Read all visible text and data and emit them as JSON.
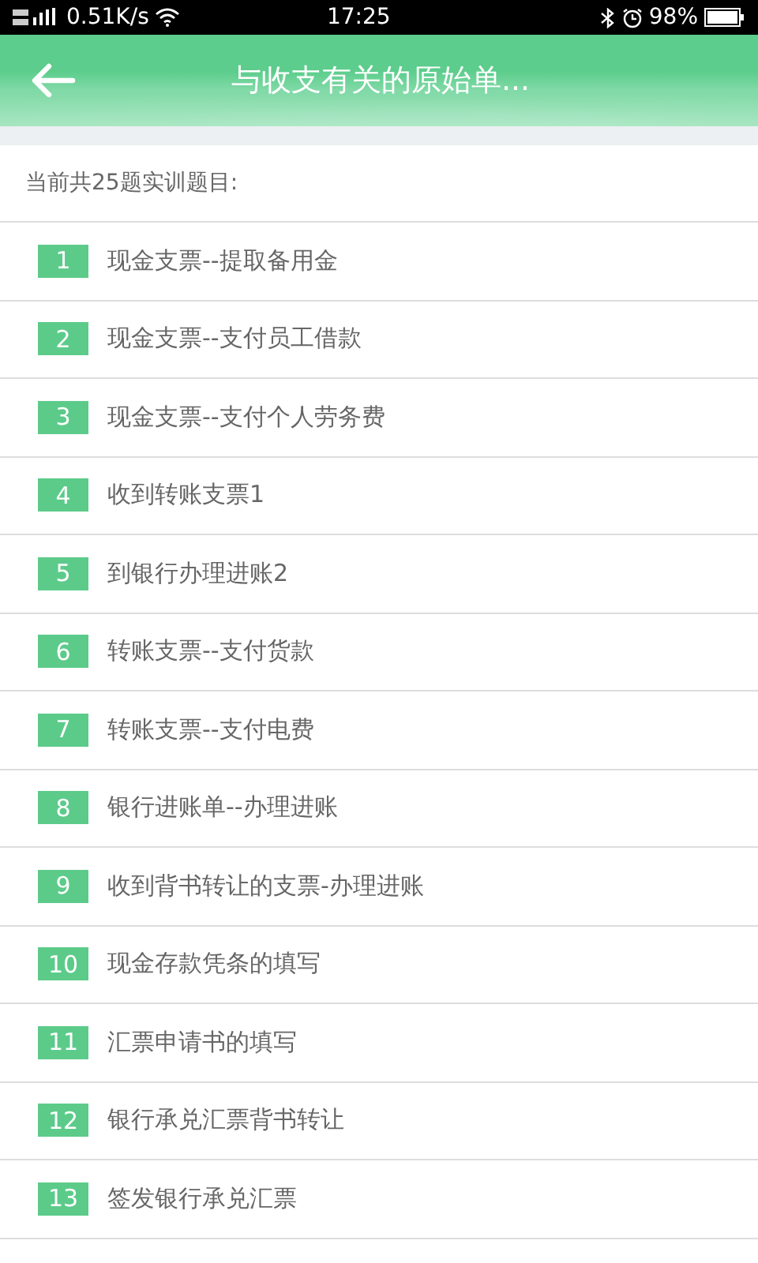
{
  "status_bar": {
    "speed": "0.51K/s",
    "time": "17:25",
    "battery": "98%"
  },
  "header": {
    "title": "与收支有关的原始单..."
  },
  "intro": "当前共25题实训题目:",
  "items": [
    {
      "number": "1",
      "title": "现金支票--提取备用金"
    },
    {
      "number": "2",
      "title": "现金支票--支付员工借款"
    },
    {
      "number": "3",
      "title": "现金支票--支付个人劳务费"
    },
    {
      "number": "4",
      "title": "收到转账支票1"
    },
    {
      "number": "5",
      "title": "到银行办理进账2"
    },
    {
      "number": "6",
      "title": "转账支票--支付货款"
    },
    {
      "number": "7",
      "title": "转账支票--支付电费"
    },
    {
      "number": "8",
      "title": "银行进账单--办理进账"
    },
    {
      "number": "9",
      "title": "收到背书转让的支票-办理进账"
    },
    {
      "number": "10",
      "title": "现金存款凭条的填写"
    },
    {
      "number": "11",
      "title": "汇票申请书的填写"
    },
    {
      "number": "12",
      "title": "银行承兑汇票背书转让"
    },
    {
      "number": "13",
      "title": "签发银行承兑汇票"
    }
  ]
}
